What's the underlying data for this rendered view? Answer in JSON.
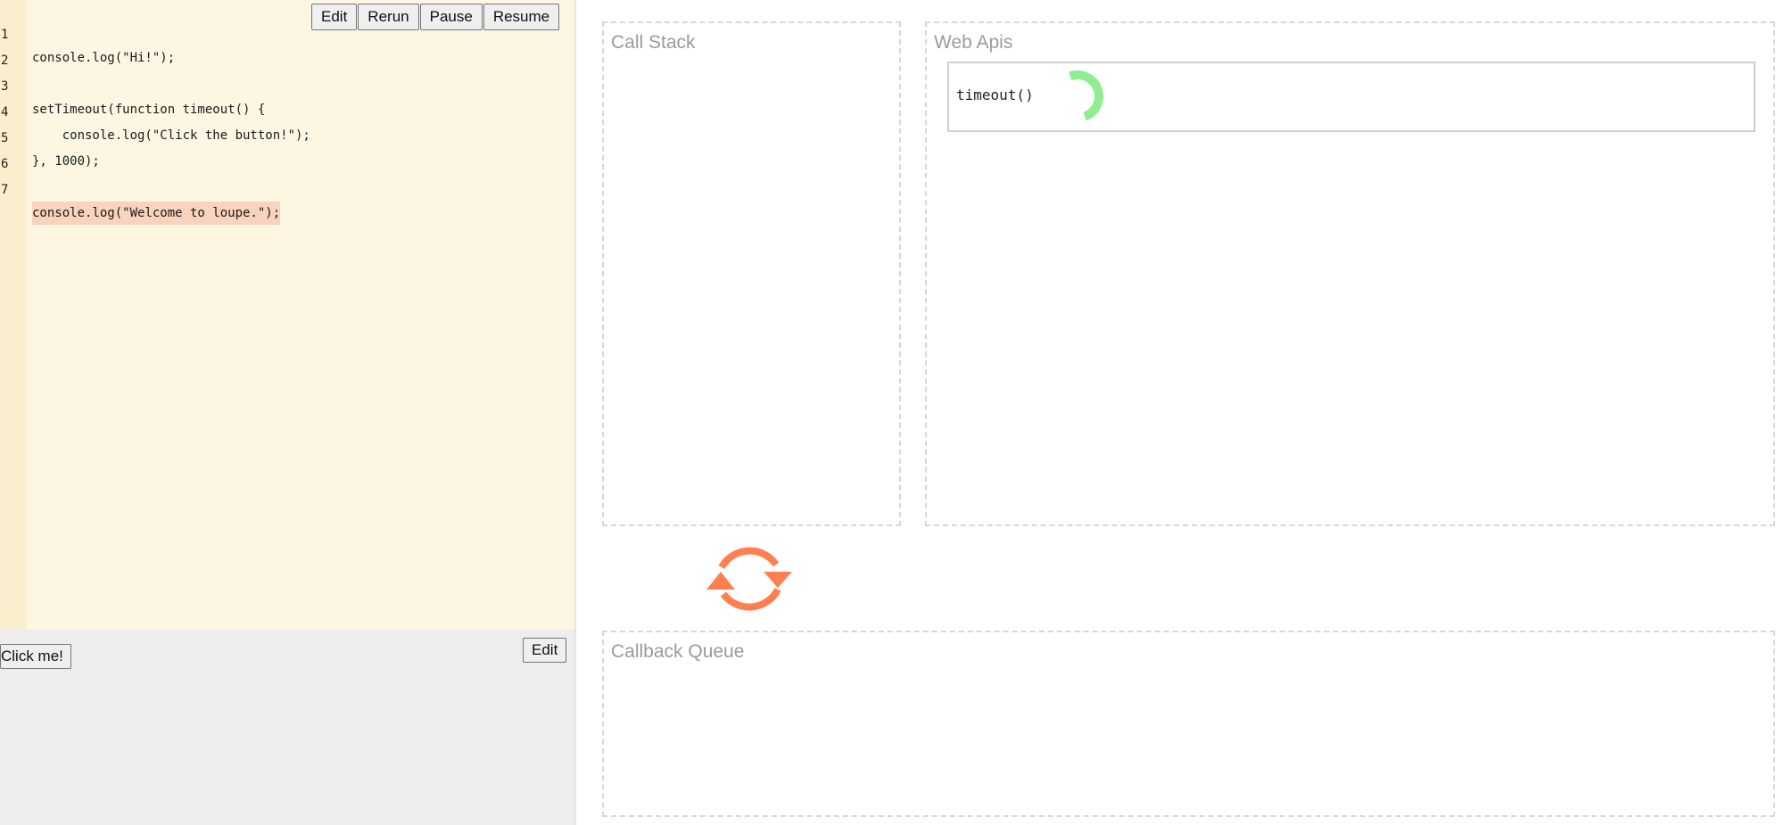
{
  "editor": {
    "toolbar": {
      "edit_label": "Edit",
      "rerun_label": "Rerun",
      "pause_label": "Pause",
      "resume_label": "Resume"
    },
    "lines": [
      {
        "num": "1",
        "code": "console.log(\"Hi!\");"
      },
      {
        "num": "2",
        "code": ""
      },
      {
        "num": "3",
        "code": "setTimeout(function timeout() {"
      },
      {
        "num": "4",
        "code": "    console.log(\"Click the button!\");"
      },
      {
        "num": "5",
        "code": "}, 1000);"
      },
      {
        "num": "6",
        "code": ""
      },
      {
        "num": "7",
        "code": "console.log(\"Welcome to loupe.\");"
      }
    ],
    "highlighted_line": "7"
  },
  "output": {
    "click_button_label": "Click me!",
    "edit_label": "Edit"
  },
  "call_stack": {
    "title": "Call Stack"
  },
  "web_apis": {
    "title": "Web Apis",
    "items": [
      {
        "label": "timeout()",
        "icon": "progress-spinner-icon",
        "color": "#90ee90"
      }
    ]
  },
  "event_loop": {
    "icon": "event-loop-icon",
    "color": "#ff7f50"
  },
  "callback_queue": {
    "title": "Callback Queue"
  }
}
